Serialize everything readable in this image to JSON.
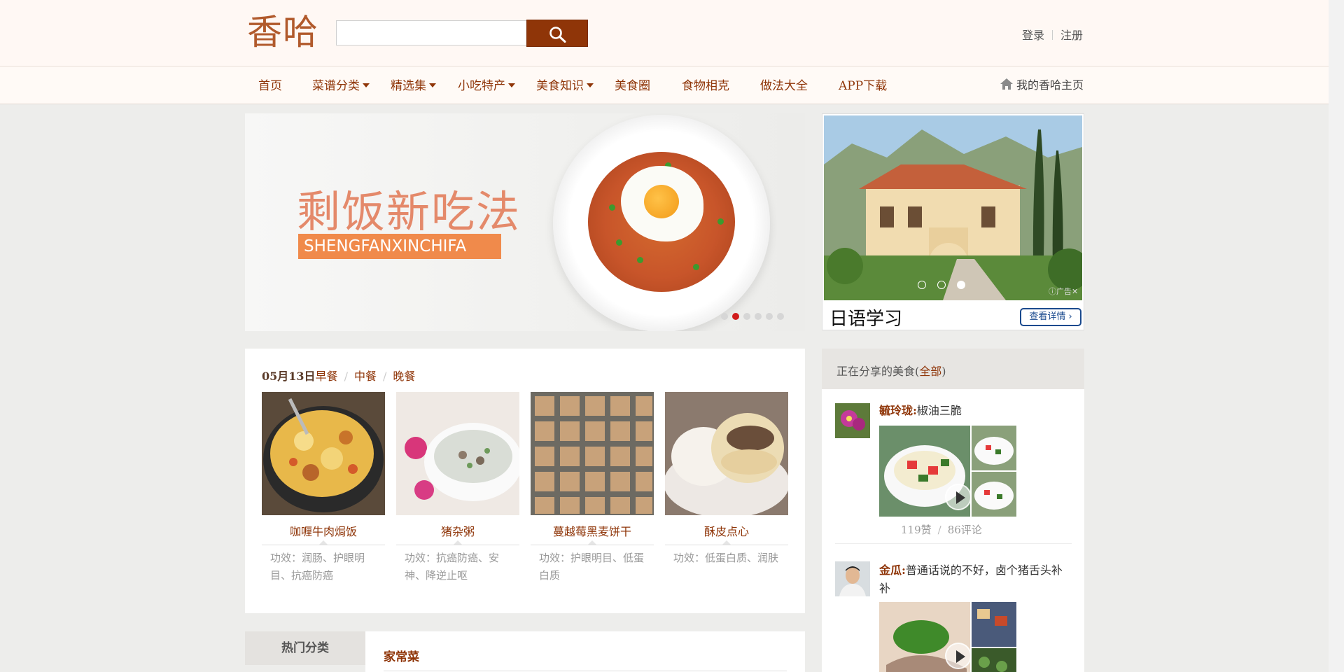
{
  "header": {
    "logo": "香哈",
    "search_placeholder": "",
    "login": "登录",
    "register": "注册"
  },
  "nav": {
    "items": [
      {
        "label": "首页"
      },
      {
        "label": "菜谱分类"
      },
      {
        "label": "精选集"
      },
      {
        "label": "小吃特产"
      },
      {
        "label": "美食知识"
      },
      {
        "label": "美食圈"
      },
      {
        "label": "食物相克"
      },
      {
        "label": "做法大全"
      },
      {
        "label": "APP下载"
      }
    ],
    "my_home": "我的香哈主页"
  },
  "banner": {
    "title": "剩饭新吃法",
    "subtitle": "SHENGFANXINCHIFA",
    "slide_count": 6,
    "active_slide": 2
  },
  "ad": {
    "text": "日语学习",
    "button": "查看详情",
    "badge": "广告"
  },
  "meals": {
    "date": "05月13日",
    "tabs": [
      "早餐",
      "中餐",
      "晚餐"
    ],
    "cards": [
      {
        "name": "咖喱牛肉焗饭",
        "effect": "功效：润肠、护眼明目、抗癌防癌"
      },
      {
        "name": "猪杂粥",
        "effect": "功效：抗癌防癌、安神、降逆止呕"
      },
      {
        "name": "蔓越莓黑麦饼干",
        "effect": "功效：护眼明目、低蛋白质"
      },
      {
        "name": "酥皮点心",
        "effect": "功效：低蛋白质、润肤"
      }
    ]
  },
  "hot": {
    "tab": "热门分类",
    "title": "家常菜"
  },
  "share": {
    "title": "正在分享的美食(",
    "all": "全部",
    "close_paren": ")",
    "posts": [
      {
        "user": "毓玲珑:",
        "text": "椒油三脆",
        "likes": "119赞",
        "sep": "/",
        "comments": "86评论"
      },
      {
        "user": "金瓜:",
        "text": "普通话说的不好，卤个猪舌头补补"
      }
    ]
  }
}
